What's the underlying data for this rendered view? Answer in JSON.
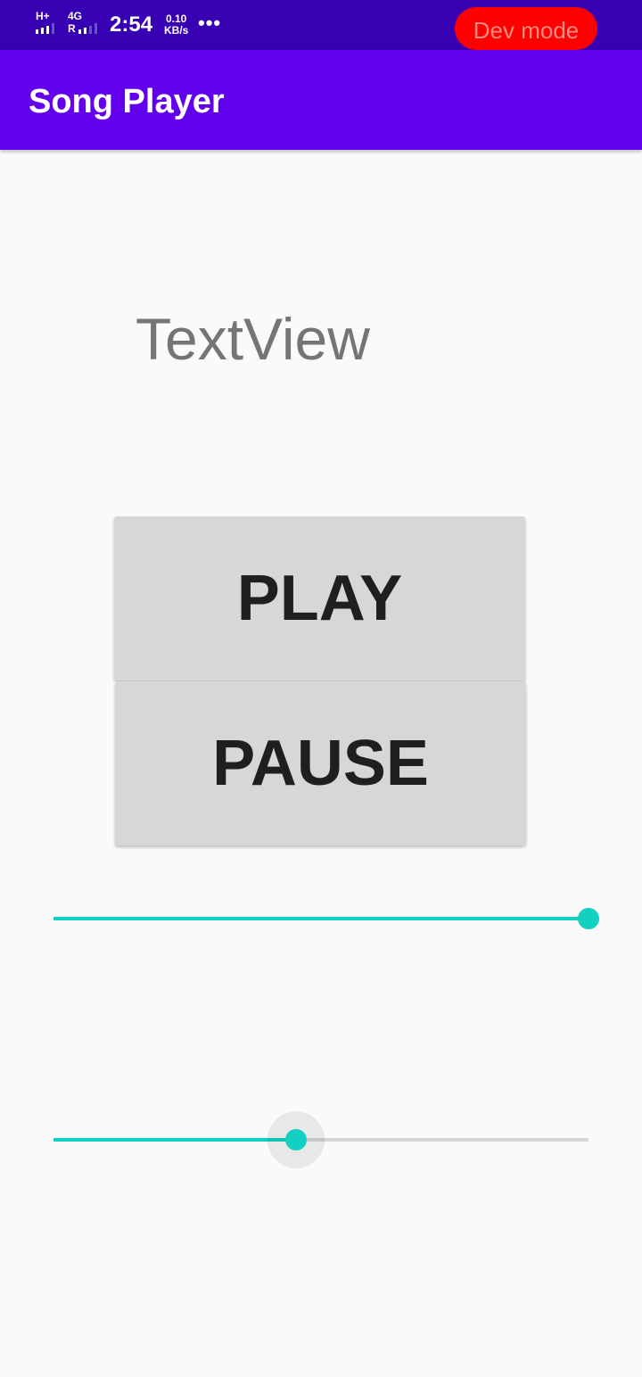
{
  "status_bar": {
    "network_1": "H+",
    "network_2": "4G",
    "network_2_sub": "R",
    "time": "2:54",
    "speed_value": "0.10",
    "speed_unit": "KB/s",
    "more": "•••",
    "dev_mode": "Dev mode"
  },
  "app_bar": {
    "title": "Song Player"
  },
  "main": {
    "textview": "TextView",
    "play_label": "PLAY",
    "pause_label": "PAUSE"
  },
  "sliders": {
    "top": {
      "progress": 1.0,
      "show_halo": false
    },
    "bottom": {
      "progress": 0.453,
      "show_halo": true
    }
  },
  "colors": {
    "status_bar": "#3700b3",
    "app_bar": "#6200ee",
    "accent": "#12d1c1",
    "dev_pill": "#ff0000"
  }
}
